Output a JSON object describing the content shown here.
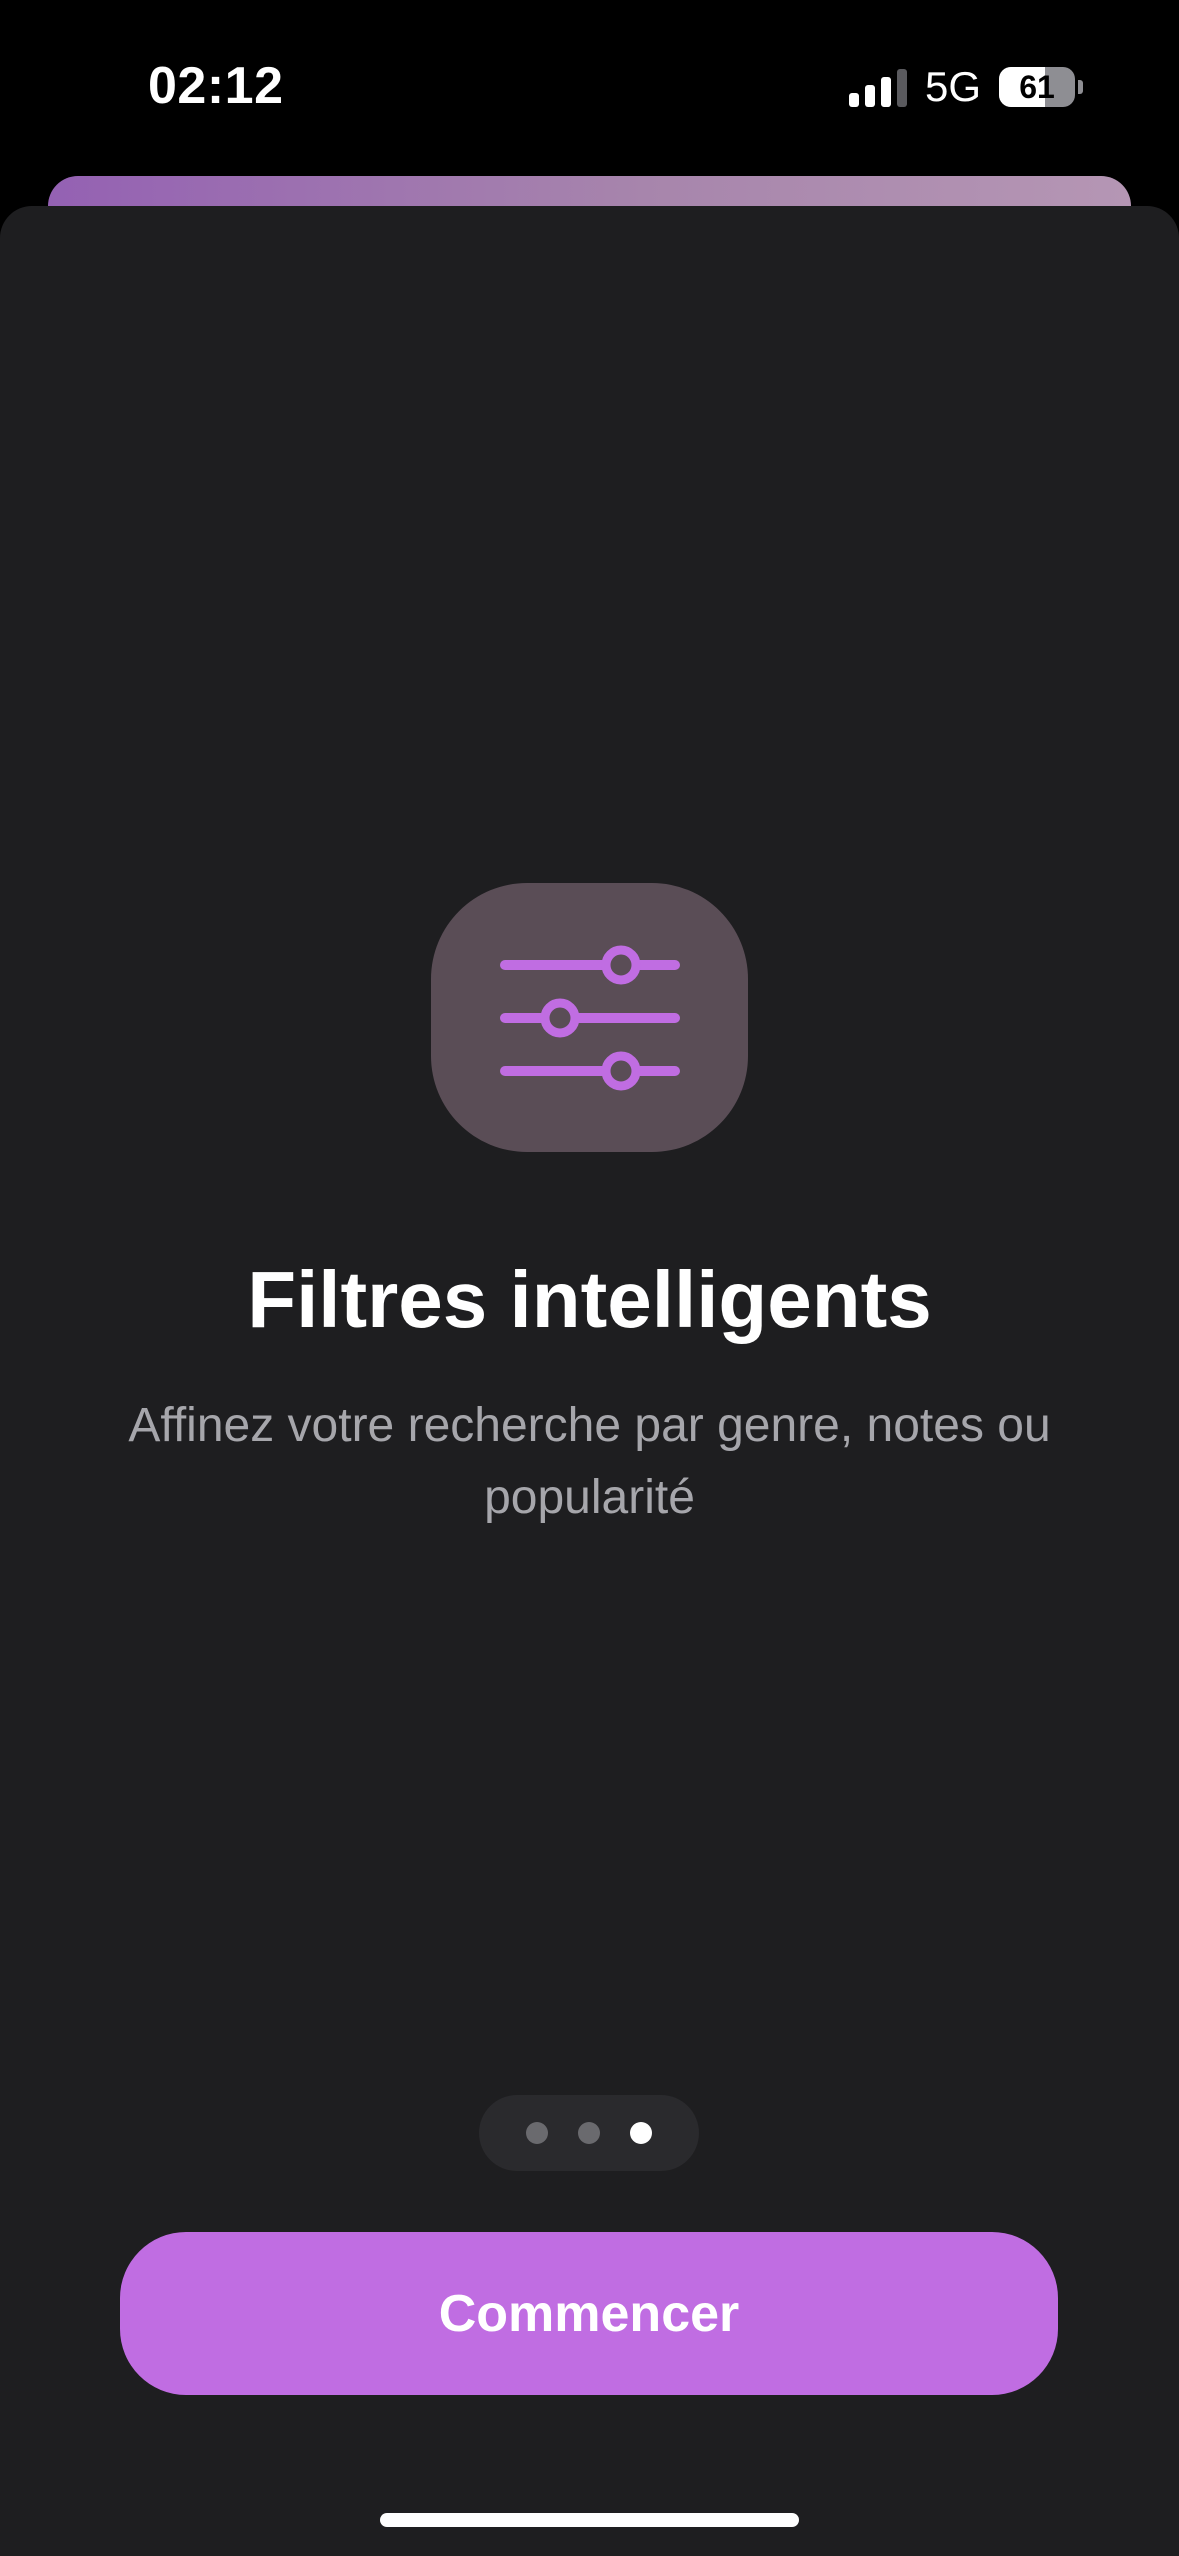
{
  "status_bar": {
    "time": "02:12",
    "network": "5G",
    "battery_level": "61",
    "battery_fraction": 0.61,
    "signal_bars_active": 3,
    "signal_bars_total": 4
  },
  "feature": {
    "icon": "sliders-icon",
    "icon_color": "#c06de2",
    "title": "Filtres intelligents",
    "description": "Affinez votre recherche par genre, notes ou popularité"
  },
  "pager": {
    "page_count": 3,
    "current_page": 3
  },
  "actions": {
    "start_label": "Commencer",
    "accent_color": "#c06de2"
  }
}
